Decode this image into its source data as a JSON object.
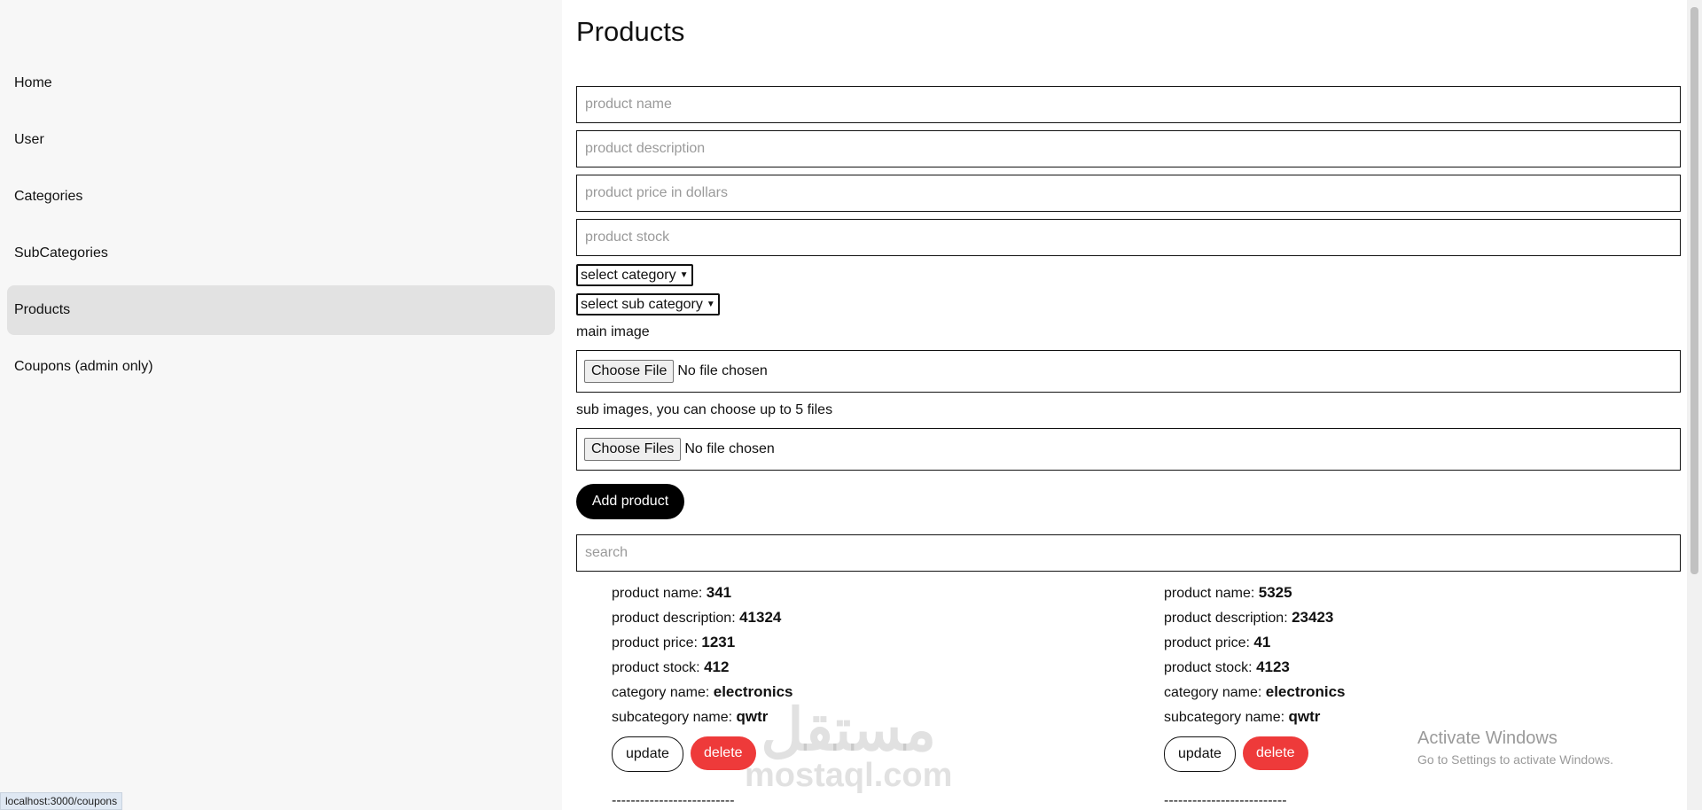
{
  "sidebar": {
    "items": [
      {
        "label": "Home",
        "active": false
      },
      {
        "label": "User",
        "active": false
      },
      {
        "label": "Categories",
        "active": false
      },
      {
        "label": "SubCategories",
        "active": false
      },
      {
        "label": "Products",
        "active": true
      },
      {
        "label": "Coupons (admin only)",
        "active": false
      }
    ]
  },
  "main": {
    "title": "Products",
    "form": {
      "name_placeholder": "product name",
      "description_placeholder": "product description",
      "price_placeholder": "product price in dollars",
      "stock_placeholder": "product stock",
      "category_select": "select category",
      "subcategory_select": "select sub category",
      "main_image_label": "main image",
      "main_image_button": "Choose File",
      "main_image_status": "No file chosen",
      "sub_images_label": "sub images, you can choose up to 5 files",
      "sub_images_button": "Choose Files",
      "sub_images_status": "No file chosen",
      "add_button": "Add product"
    },
    "search_placeholder": "search",
    "labels": {
      "name": "product name:",
      "description": "product description:",
      "price": "product price:",
      "stock": "product stock:",
      "category": "category name:",
      "subcategory": "subcategory name:",
      "update": "update",
      "delete": "delete",
      "separator": "--------------------------"
    },
    "products": [
      {
        "name": "341",
        "description": "41324",
        "price": "1231",
        "stock": "412",
        "category": "electronics",
        "subcategory": "qwtr"
      },
      {
        "name": "5325",
        "description": "23423",
        "price": "41",
        "stock": "4123",
        "category": "electronics",
        "subcategory": "qwtr"
      }
    ]
  },
  "status_bar_url": "localhost:3000/coupons",
  "os_overlay": {
    "line1": "Activate Windows",
    "line2": "Go to Settings to activate Windows."
  },
  "watermark": {
    "arabic": "مستقل",
    "latin": "mostaql.com"
  },
  "colors": {
    "delete": "#ee3a3a",
    "add": "#000000",
    "active_nav": "#e2e2e2"
  }
}
